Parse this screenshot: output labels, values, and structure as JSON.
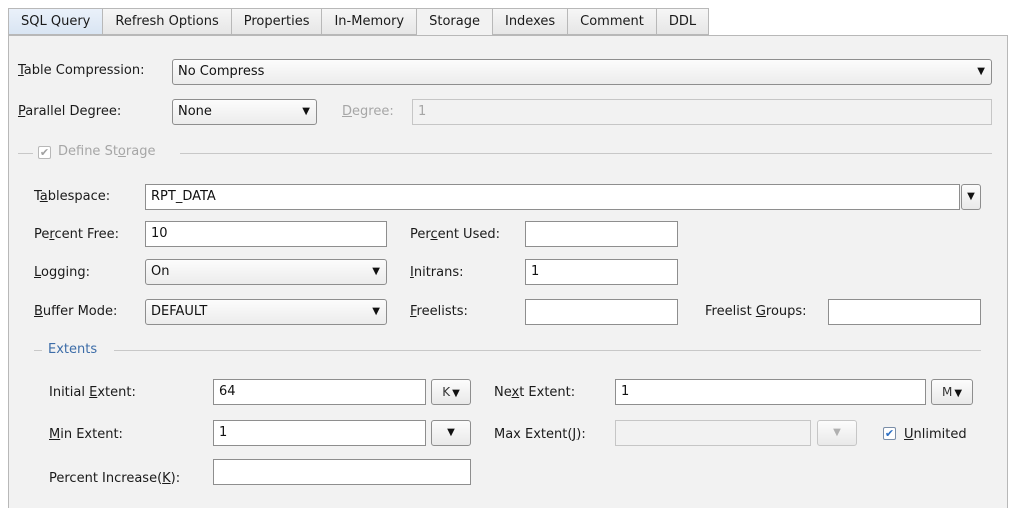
{
  "tabs": [
    {
      "label": "SQL Query"
    },
    {
      "label": "Refresh Options"
    },
    {
      "label": "Properties"
    },
    {
      "label": "In-Memory"
    },
    {
      "label": "Storage"
    },
    {
      "label": "Indexes"
    },
    {
      "label": "Comment"
    },
    {
      "label": "DDL"
    }
  ],
  "active_tab": "Storage",
  "table_compression": {
    "label": "Table Compression:",
    "value": "No Compress"
  },
  "parallel_degree": {
    "label": "Parallel Degree:",
    "value": "None"
  },
  "degree": {
    "label": "Degree:",
    "value": "1"
  },
  "define_storage": {
    "label": "Define Storage",
    "checked": true
  },
  "tablespace": {
    "label": "Tablespace:",
    "value": "RPT_DATA"
  },
  "percent_free": {
    "label": "Percent Free:",
    "value": "10"
  },
  "percent_used": {
    "label": "Percent Used:",
    "value": ""
  },
  "logging": {
    "label": "Logging:",
    "value": "On"
  },
  "initrans": {
    "label": "Initrans:",
    "value": "1"
  },
  "buffer_mode": {
    "label": "Buffer Mode:",
    "value": "DEFAULT"
  },
  "freelists": {
    "label": "Freelists:",
    "value": ""
  },
  "freelist_groups": {
    "label": "Freelist Groups:",
    "value": ""
  },
  "extents": {
    "title": "Extents",
    "initial_extent": {
      "label": "Initial Extent:",
      "value": "64",
      "unit": "K"
    },
    "next_extent": {
      "label": "Next Extent:",
      "value": "1",
      "unit": "M"
    },
    "min_extent": {
      "label": "Min Extent:",
      "value": "1",
      "unit": ""
    },
    "max_extent": {
      "label": "Max Extent(J):",
      "value": "",
      "unit": ""
    },
    "unlimited": {
      "label": "Unlimited",
      "checked": true
    },
    "percent_increase": {
      "label": "Percent Increase(K):",
      "value": ""
    }
  }
}
